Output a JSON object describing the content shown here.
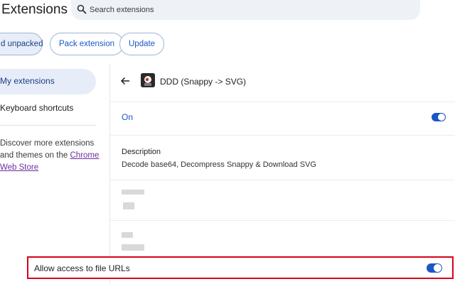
{
  "header": {
    "title": "Extensions",
    "search_placeholder": "Search extensions"
  },
  "toolbar": {
    "load_unpacked_label": "d unpacked",
    "pack_label": "Pack extension",
    "update_label": "Update"
  },
  "sidebar": {
    "my_extensions": "My extensions",
    "keyboard_shortcuts": "Keyboard shortcuts",
    "discover_prefix": "Discover more extensions and themes on the ",
    "web_store_link": "Chrome Web Store"
  },
  "details": {
    "extension_name": "DDD (Snappy -> SVG)",
    "on_label": "On",
    "on_state": true,
    "description_title": "Description",
    "description_text": "Decode base64, Decompress Snappy & Download SVG",
    "file_access_label": "Allow access to file URLs",
    "file_access_state": true
  },
  "colors": {
    "accent": "#1b57c5",
    "highlight_border": "#d9001b",
    "link_visited": "#6b2f9a"
  }
}
